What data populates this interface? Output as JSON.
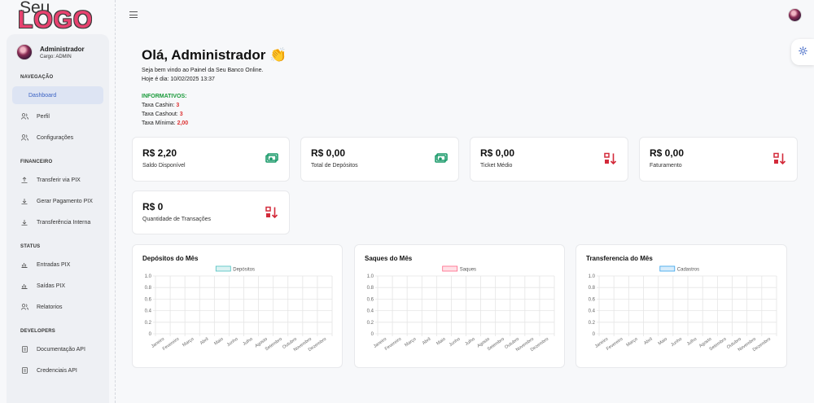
{
  "logo": {
    "line1": "Seu",
    "line2": "LOGO"
  },
  "user": {
    "name": "Administrador",
    "role": "Cargo: ADMIN"
  },
  "sidebar": {
    "sections": [
      {
        "title": "NAVEGAÇÃO",
        "items": [
          {
            "label": "Dashboard",
            "icon": "home-icon",
            "active": true
          },
          {
            "label": "Perfil",
            "icon": "users-icon"
          },
          {
            "label": "Configurações",
            "icon": "users-icon"
          }
        ]
      },
      {
        "title": "FINANCEIRO",
        "items": [
          {
            "label": "Transferir via PIX",
            "icon": "upload-icon"
          },
          {
            "label": "Gerar Pagamento PIX",
            "icon": "download-icon"
          },
          {
            "label": "Transferência Interna",
            "icon": "download-icon"
          }
        ]
      },
      {
        "title": "STATUS",
        "items": [
          {
            "label": "Entradas PIX",
            "icon": "chart-icon"
          },
          {
            "label": "Saídas PIX",
            "icon": "chart-icon"
          },
          {
            "label": "Relatorios",
            "icon": "users-icon"
          }
        ]
      },
      {
        "title": "DEVELOPERS",
        "items": [
          {
            "label": "Documentação API",
            "icon": "document-icon"
          },
          {
            "label": "Credenciais API",
            "icon": "document-icon"
          }
        ]
      }
    ]
  },
  "header": {
    "greeting": "Olá, Administrador 👏",
    "welcome": "Seja bem vindo ao Painel da Seu Banco Online.",
    "date": "Hoje é dia: 10/02/2025 13:37"
  },
  "informativos": {
    "title": "INFORMATIVOS:",
    "cashin_label": "Taxa Cashin:",
    "cashin_value": "3",
    "cashout_label": "Taxa Cashout:",
    "cashout_value": "3",
    "minima_label": "Taxa Mínima:",
    "minima_value": "2,00"
  },
  "cards": [
    {
      "value": "R$ 2,20",
      "caption": "Saldo Disponível",
      "icon": "money-icon"
    },
    {
      "value": "R$ 0,00",
      "caption": "Total de Depósitos",
      "icon": "money-icon"
    },
    {
      "value": "R$ 0,00",
      "caption": "Ticket Médio",
      "icon": "sort-icon"
    },
    {
      "value": "R$ 0,00",
      "caption": "Faturamento",
      "icon": "sort-icon"
    },
    {
      "value": "R$ 0",
      "caption": "Quantidade de Transações",
      "icon": "sort-icon"
    }
  ],
  "colors": {
    "money": "#1a9a6a",
    "sort": "#d32a3a",
    "accent": "#3b63c4"
  },
  "chart_data": [
    {
      "type": "bar",
      "title": "Depósitos do Mês",
      "categories": [
        "Janeiro",
        "Fevereiro",
        "Março",
        "Abril",
        "Maio",
        "Junho",
        "Julho",
        "Agosto",
        "Setembro",
        "Outubro",
        "Novembro",
        "Dezembro"
      ],
      "series": [
        {
          "name": "Depósitos",
          "values": [
            0,
            0,
            0,
            0,
            0,
            0,
            0,
            0,
            0,
            0,
            0,
            0
          ]
        }
      ],
      "yticks": [
        "1.0",
        "0.8",
        "0.6",
        "0.4",
        "0.2",
        "0"
      ],
      "ylim": [
        0,
        1
      ],
      "grid": true,
      "legend": "top",
      "color": "#4bc0c0"
    },
    {
      "type": "bar",
      "title": "Saques do Mês",
      "categories": [
        "Janeiro",
        "Fevereiro",
        "Março",
        "Abril",
        "Maio",
        "Junho",
        "Julho",
        "Agosto",
        "Setembro",
        "Outubro",
        "Novembro",
        "Dezembro"
      ],
      "series": [
        {
          "name": "Saques",
          "values": [
            0,
            0,
            0,
            0,
            0,
            0,
            0,
            0,
            0,
            0,
            0,
            0
          ]
        }
      ],
      "yticks": [
        "1.0",
        "0.8",
        "0.6",
        "0.4",
        "0.2",
        "0"
      ],
      "ylim": [
        0,
        1
      ],
      "grid": true,
      "legend": "top",
      "color": "#ff6384"
    },
    {
      "type": "bar",
      "title": "Transferencia do Mês",
      "categories": [
        "Janeiro",
        "Fevereiro",
        "Março",
        "Abril",
        "Maio",
        "Junho",
        "Julho",
        "Agosto",
        "Setembro",
        "Outubro",
        "Novembro",
        "Dezembro"
      ],
      "series": [
        {
          "name": "Cadastros",
          "values": [
            0,
            0,
            0,
            0,
            0,
            0,
            0,
            0,
            0,
            0,
            0,
            0
          ]
        }
      ],
      "yticks": [
        "1.0",
        "0.8",
        "0.6",
        "0.4",
        "0.2",
        "0"
      ],
      "ylim": [
        0,
        1
      ],
      "grid": true,
      "legend": "top",
      "color": "#36a2eb"
    }
  ]
}
